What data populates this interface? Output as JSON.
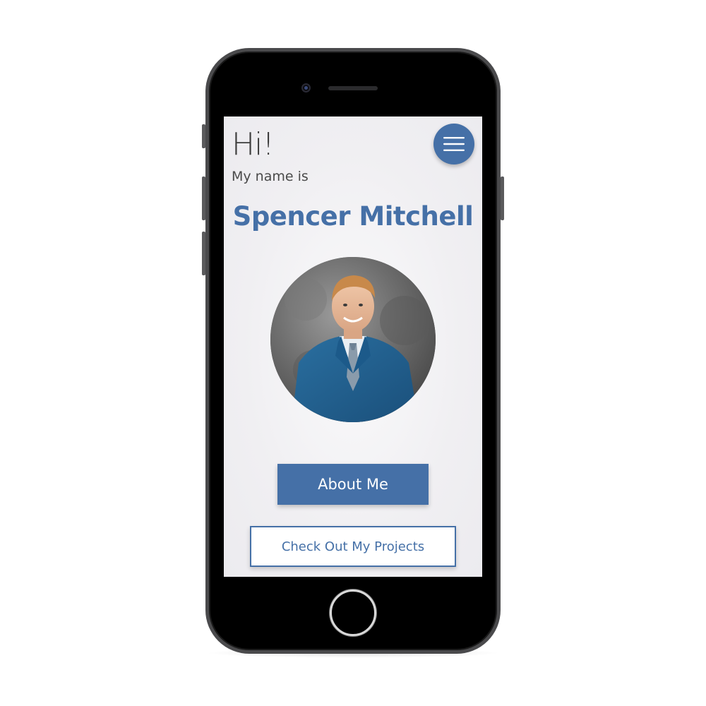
{
  "greeting": {
    "hi": "Hi!",
    "intro": "My name is",
    "name": "Spencer Mitchell"
  },
  "header": {
    "menu_icon": "hamburger-menu-icon"
  },
  "profile": {
    "photo": "profile-photo"
  },
  "actions": {
    "about_label": "About Me",
    "projects_label": "Check Out My Projects"
  },
  "colors": {
    "accent": "#4570a7",
    "background": "#f0eff2",
    "text": "#3d3d3d"
  }
}
